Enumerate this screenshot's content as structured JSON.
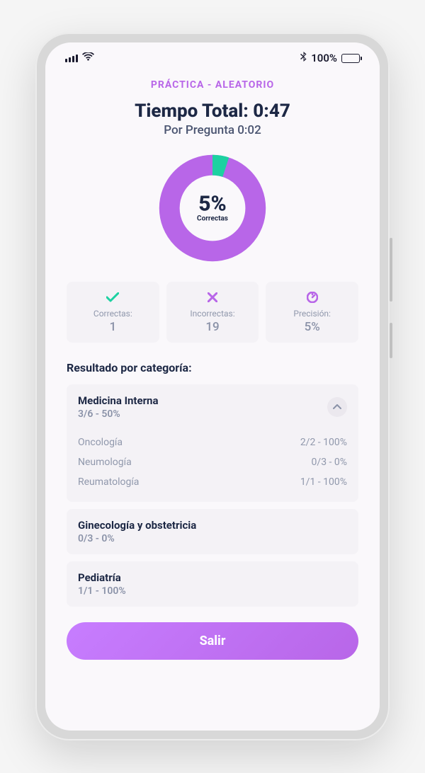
{
  "status": {
    "battery_percent": "100%"
  },
  "mode_label": "PRÁCTICA - ALEATORIO",
  "total_time_label": "Tiempo Total: 0:47",
  "per_question_label": "Por Pregunta 0:02",
  "chart_data": {
    "type": "pie",
    "title": "Correctas",
    "series": [
      {
        "name": "Correctas",
        "value": 5,
        "color": "#1dd1a1"
      },
      {
        "name": "Incorrectas",
        "value": 95,
        "color": "#b866e8"
      }
    ],
    "center_percent": "5%",
    "center_label": "Correctas"
  },
  "stats": {
    "correct": {
      "label": "Correctas:",
      "value": "1"
    },
    "incorrect": {
      "label": "Incorrectas:",
      "value": "19"
    },
    "precision": {
      "label": "Precisión:",
      "value": "5%"
    }
  },
  "results_heading": "Resultado por categoría:",
  "categories": [
    {
      "name": "Medicina Interna",
      "score": "3/6 - 50%",
      "expanded": true,
      "sub": [
        {
          "name": "Oncología",
          "score": "2/2 - 100%"
        },
        {
          "name": "Neumología",
          "score": "0/3 - 0%"
        },
        {
          "name": "Reumatología",
          "score": "1/1 - 100%"
        }
      ]
    },
    {
      "name": "Ginecología y obstetricia",
      "score": "0/3 - 0%",
      "expanded": false
    },
    {
      "name": "Pediatría",
      "score": "1/1 - 100%",
      "expanded": false
    }
  ],
  "exit_label": "Salir"
}
